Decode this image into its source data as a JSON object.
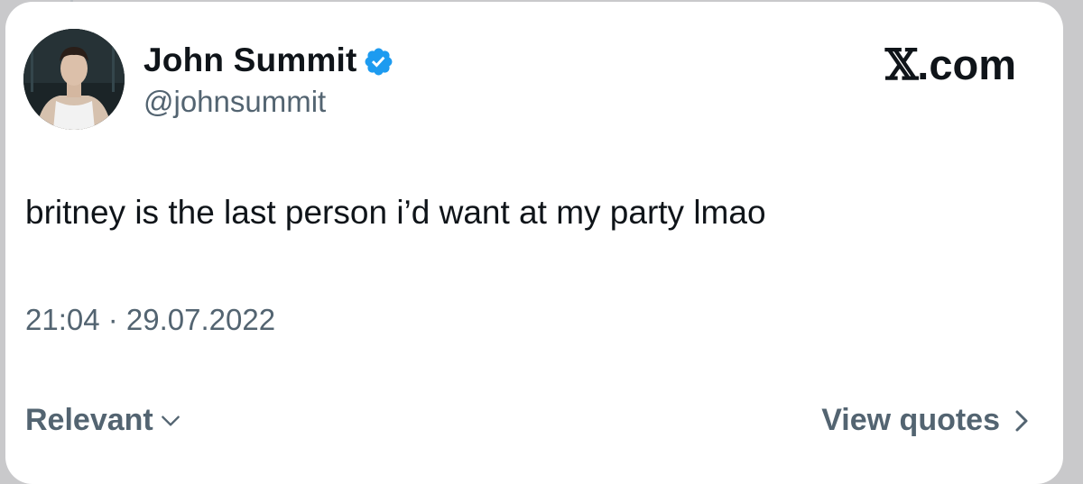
{
  "tweet": {
    "author": {
      "display_name": "John Summit",
      "handle": "@johnsummit",
      "verified": true
    },
    "brand": {
      "symbol": "𝕏",
      "suffix": ".com"
    },
    "text": "britney is the last person i’d want at my party lmao",
    "timestamp": "21:04 · 29.07.2022"
  },
  "footer": {
    "sort_label": "Relevant",
    "quotes_label": "View quotes"
  },
  "icons": {
    "verified": "verified-badge-icon",
    "sort": "chevron-down-icon",
    "quotes": "chevron-right-icon"
  },
  "colors": {
    "text_primary": "#0f1419",
    "text_secondary": "#536471",
    "verified_blue": "#1d9bf0",
    "card_background": "#ffffff"
  }
}
